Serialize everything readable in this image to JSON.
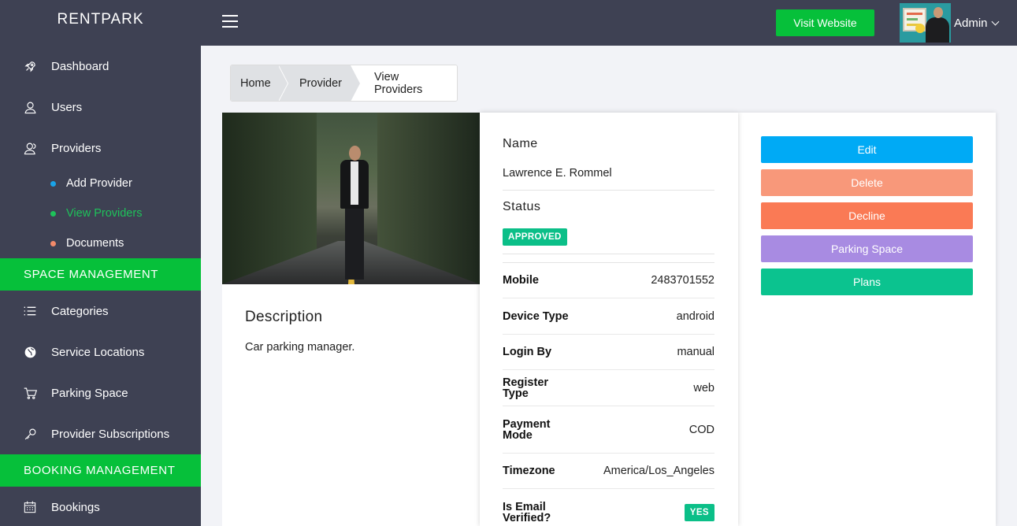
{
  "app": {
    "brand": "RENTPARK"
  },
  "sidebar": {
    "items": [
      {
        "label": "Dashboard",
        "icon": "rocket-icon"
      },
      {
        "label": "Users",
        "icon": "user-icon"
      },
      {
        "label": "Providers",
        "icon": "users-icon"
      }
    ],
    "sub_items": [
      {
        "label": "Add Provider",
        "dot_color": "#1aa3e8"
      },
      {
        "label": "View Providers",
        "dot_color": "#1ec25a",
        "active": true
      },
      {
        "label": "Documents",
        "dot_color": "#f28a6a"
      }
    ],
    "section_space": "SPACE MANAGEMENT",
    "space_items": [
      {
        "label": "Categories",
        "icon": "list-icon"
      },
      {
        "label": "Service Locations",
        "icon": "globe-icon"
      },
      {
        "label": "Parking Space",
        "icon": "cart-icon"
      },
      {
        "label": "Provider Subscriptions",
        "icon": "key-icon"
      }
    ],
    "section_booking": "BOOKING MANAGEMENT",
    "booking_items": [
      {
        "label": "Bookings",
        "icon": "calendar-icon"
      }
    ]
  },
  "topbar": {
    "visit_label": "Visit Website",
    "admin_label": "Admin"
  },
  "breadcrumb": [
    "Home",
    "Provider",
    "View Providers"
  ],
  "profile": {
    "description_title": "Description",
    "description_text": "Car parking manager.",
    "name_label": "Name",
    "name_value": "Lawrence E. Rommel",
    "status_label": "Status",
    "status_value": "APPROVED",
    "details": [
      {
        "key": "Mobile",
        "value": "2483701552"
      },
      {
        "key": "Device Type",
        "value": "android"
      },
      {
        "key": "Login By",
        "value": "manual"
      },
      {
        "key": "Register Type",
        "value": "web"
      },
      {
        "key": "Payment Mode",
        "value": "COD"
      },
      {
        "key": "Timezone",
        "value": "America/Los_Angeles"
      },
      {
        "key": "Is Email Verified?",
        "value": "YES"
      }
    ]
  },
  "actions": [
    {
      "label": "Edit",
      "color": "#00aaf5"
    },
    {
      "label": "Delete",
      "color": "#f8987a"
    },
    {
      "label": "Decline",
      "color": "#fa7a55"
    },
    {
      "label": "Parking Space",
      "color": "#a88be2"
    },
    {
      "label": "Plans",
      "color": "#0bc38f"
    }
  ],
  "colors": {
    "sidebar_bg": "#3e4153",
    "accent_green": "#06c03a",
    "badge_green": "#0bbf88"
  }
}
